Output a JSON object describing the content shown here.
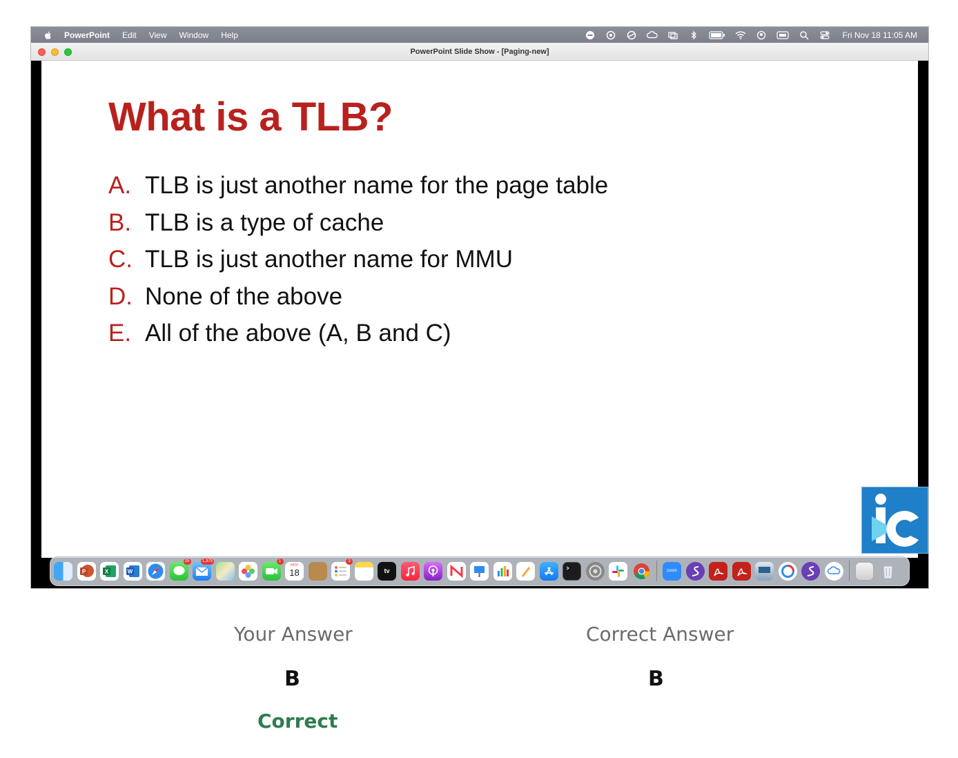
{
  "menubar": {
    "app_name": "PowerPoint",
    "menus": [
      "Edit",
      "View",
      "Window",
      "Help"
    ],
    "clock": "Fri Nov 18  11:05 AM",
    "status_icons": [
      "screen-record-icon",
      "sync-icon",
      "no-entry-icon",
      "creative-cloud-icon",
      "screen-mirroring-icon",
      "bluetooth-icon",
      "battery-icon",
      "wifi-icon",
      "user-icon",
      "keyboard-icon",
      "spotlight-search-icon",
      "control-center-icon"
    ]
  },
  "window": {
    "title": "PowerPoint Slide Show - [Paging-new]"
  },
  "slide": {
    "title": "What is a TLB?",
    "options": [
      {
        "letter": "A.",
        "text": "TLB is just another name for the page table"
      },
      {
        "letter": "B.",
        "text": "TLB is a type of cache"
      },
      {
        "letter": "C.",
        "text": "TLB is just another name for MMU"
      },
      {
        "letter": "D.",
        "text": "None of the above"
      },
      {
        "letter": "E.",
        "text": "All of the above (A, B and C)"
      }
    ],
    "logo_icon": "iclicker-logo-icon"
  },
  "dock": {
    "badges": {
      "messages": "25",
      "mail": "1,375",
      "facetime": "1",
      "reminders": "3"
    },
    "calendar_month": "NOV",
    "calendar_day": "18",
    "appletv_label": "tv",
    "zoom_label": "zoom"
  },
  "answers": {
    "your_heading": "Your Answer",
    "correct_heading": "Correct Answer",
    "your_value": "B",
    "correct_value": "B",
    "result": "Correct"
  },
  "colors": {
    "title_red": "#b8211d",
    "result_green": "#2e7d4f",
    "heading_gray": "#6b6b6b"
  }
}
